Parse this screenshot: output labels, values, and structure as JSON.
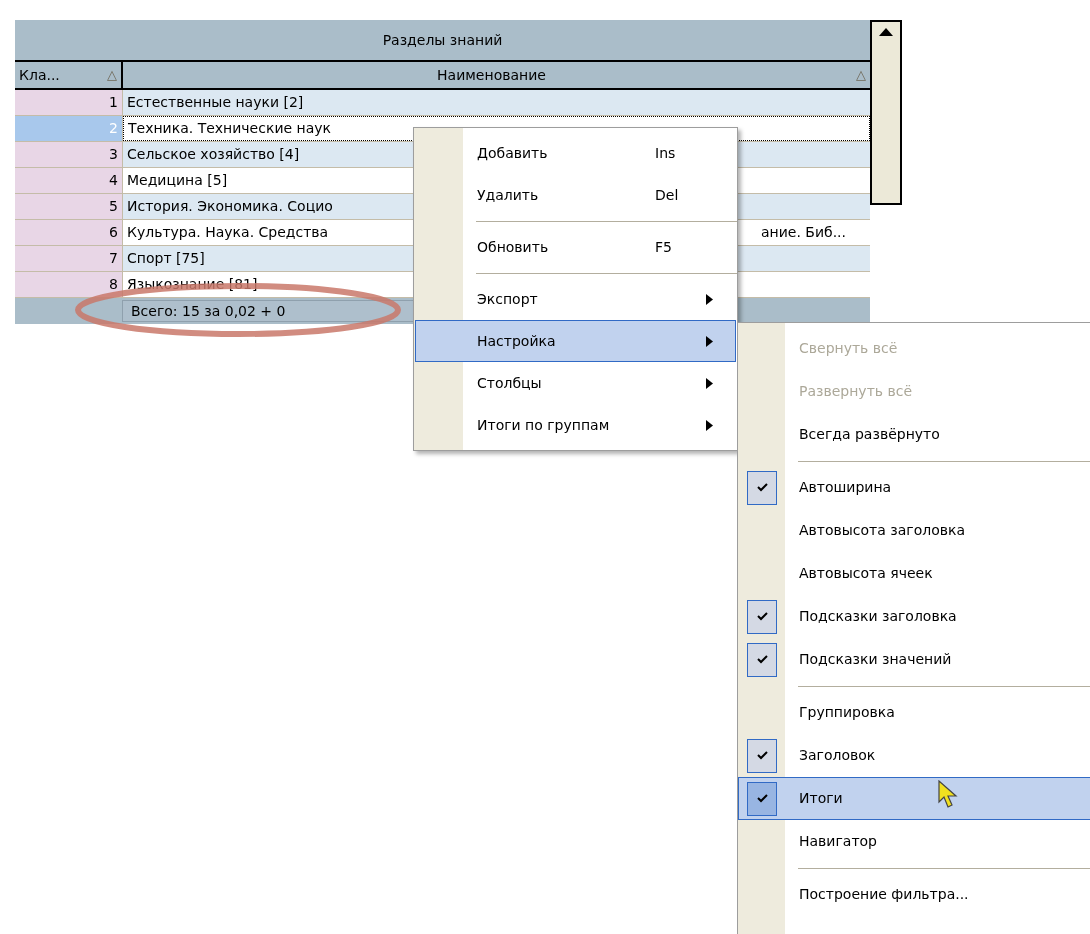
{
  "grid": {
    "title": "Разделы знаний",
    "columns": [
      {
        "label": "Кла...",
        "sort_icon": "△"
      },
      {
        "label": "Наименование",
        "sort_icon": "△"
      }
    ],
    "rows": [
      {
        "key": "1",
        "name": "Естественные науки [2]",
        "selected": false
      },
      {
        "key": "2",
        "name": "Техника. Технические наук",
        "selected": true
      },
      {
        "key": "3",
        "name": "Сельское хозяйство [4]",
        "selected": false
      },
      {
        "key": "4",
        "name": "Медицина [5]",
        "selected": false
      },
      {
        "key": "5",
        "name": "История. Экономика. Социо",
        "selected": false
      },
      {
        "key": "6",
        "name": "Культура. Наука. Средства",
        "name_tail": "ание. Биб...",
        "selected": false
      },
      {
        "key": "7",
        "name": "Спорт [75]",
        "selected": false
      },
      {
        "key": "8",
        "name": "Языкознание [81]",
        "selected": false
      }
    ],
    "footer": "Всего: 15 за 0,02 + 0"
  },
  "context_menu": {
    "items": [
      {
        "kind": "item",
        "label": "Добавить",
        "shortcut": "Ins",
        "submenu": false,
        "selected": false
      },
      {
        "kind": "item",
        "label": "Удалить",
        "shortcut": "Del",
        "submenu": false,
        "selected": false
      },
      {
        "kind": "separator"
      },
      {
        "kind": "item",
        "label": "Обновить",
        "shortcut": "F5",
        "submenu": false,
        "selected": false
      },
      {
        "kind": "separator"
      },
      {
        "kind": "item",
        "label": "Экспорт",
        "submenu": true,
        "selected": false
      },
      {
        "kind": "item",
        "label": "Настройка",
        "submenu": true,
        "selected": true
      },
      {
        "kind": "item",
        "label": "Столбцы",
        "submenu": true,
        "selected": false
      },
      {
        "kind": "item",
        "label": "Итоги по группам",
        "submenu": true,
        "selected": false
      }
    ]
  },
  "submenu": {
    "items": [
      {
        "kind": "item",
        "label": "Свернуть всё",
        "checked": false,
        "disabled": true,
        "selected": false
      },
      {
        "kind": "item",
        "label": "Развернуть всё",
        "checked": false,
        "disabled": true,
        "selected": false
      },
      {
        "kind": "item",
        "label": "Всегда развёрнуто",
        "checked": false,
        "disabled": false,
        "selected": false
      },
      {
        "kind": "separator"
      },
      {
        "kind": "item",
        "label": "Автоширина",
        "checked": true,
        "disabled": false,
        "selected": false
      },
      {
        "kind": "item",
        "label": "Автовысота заголовка",
        "checked": false,
        "disabled": false,
        "selected": false
      },
      {
        "kind": "item",
        "label": "Автовысота ячеек",
        "checked": false,
        "disabled": false,
        "selected": false
      },
      {
        "kind": "item",
        "label": "Подсказки заголовка",
        "checked": true,
        "disabled": false,
        "selected": false
      },
      {
        "kind": "item",
        "label": "Подсказки значений",
        "checked": true,
        "disabled": false,
        "selected": false
      },
      {
        "kind": "separator"
      },
      {
        "kind": "item",
        "label": "Группировка",
        "checked": false,
        "disabled": false,
        "selected": false
      },
      {
        "kind": "item",
        "label": "Заголовок",
        "checked": true,
        "disabled": false,
        "selected": false
      },
      {
        "kind": "item",
        "label": "Итоги",
        "checked": true,
        "disabled": false,
        "selected": true
      },
      {
        "kind": "item",
        "label": "Навигатор",
        "checked": false,
        "disabled": false,
        "selected": false
      },
      {
        "kind": "separator"
      },
      {
        "kind": "item",
        "label": "Построение фильтра...",
        "checked": false,
        "disabled": false,
        "selected": false
      }
    ]
  }
}
